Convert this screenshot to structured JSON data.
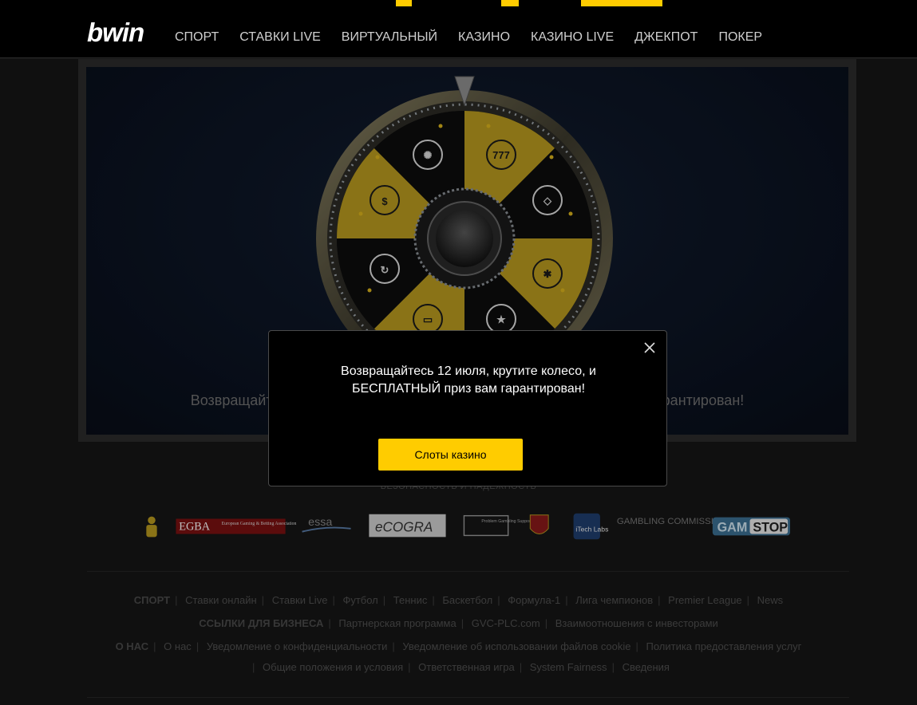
{
  "header": {
    "logo": "bwin",
    "nav": [
      "СПОРТ",
      "СТАВКИ LIVE",
      "ВИРТУАЛЬНЫЙ",
      "КАЗИНО",
      "КАЗИНО LIVE",
      "ДЖЕКПОТ",
      "ПОКЕР"
    ]
  },
  "promo": {
    "text": "Возвращайтесь 12 июля, крутите колесо, и БЕСПЛАТНЫЙ приз вам гарантирован!",
    "wheel_icons": [
      "casino-chip-icon",
      "777-icon",
      "diamond-icon",
      "poker-chip-icon",
      "stars-icon",
      "ticket-icon",
      "refresh-icon",
      "dollar-icon"
    ]
  },
  "footer": {
    "security_heading": "БЕЗОПАСНОСТЬ И НАДЕЖНОСТЬ",
    "logos": {
      "egba": "EGBA",
      "egba_sub": "European Gaming & Betting Association",
      "essa": "essa",
      "ecogra": "eCOGRA",
      "pgs": "Problem Gambling Support",
      "itech": "iTech Labs",
      "gambling_commission": "GAMBLING COMMISSION",
      "gamstop_a": "GAM",
      "gamstop_b": "STOP"
    },
    "rows": [
      {
        "head": "СПОРТ",
        "links": [
          "Ставки онлайн",
          "Ставки Live",
          "Футбол",
          "Теннис",
          "Баскетбол",
          "Формула-1",
          "Лига чемпионов",
          "Premier League",
          "News"
        ]
      },
      {
        "head": "ССЫЛКИ ДЛЯ БИЗНЕСА",
        "links": [
          "Партнерская программа",
          "GVC-PLC.com",
          "Взаимоотношения с инвесторами"
        ]
      },
      {
        "head": "О НАС",
        "links": [
          "О нас",
          "Уведомление о конфиденциальности",
          "Уведомление об использовании файлов cookie",
          "Политика предоставления услуг"
        ]
      },
      {
        "head": "",
        "links": [
          "Общие положения и условия",
          "Ответственная игра",
          "System Fairness",
          "Сведения"
        ]
      }
    ]
  },
  "modal": {
    "line1": "Возвращайтесь 12 июля, крутите колесо, и",
    "line2": "БЕСПЛАТНЫЙ приз вам гарантирован!",
    "button": "Слоты казино"
  },
  "colors": {
    "accent": "#ffcc00",
    "wheel_gold": "#b89a1f",
    "background": "#161616"
  }
}
